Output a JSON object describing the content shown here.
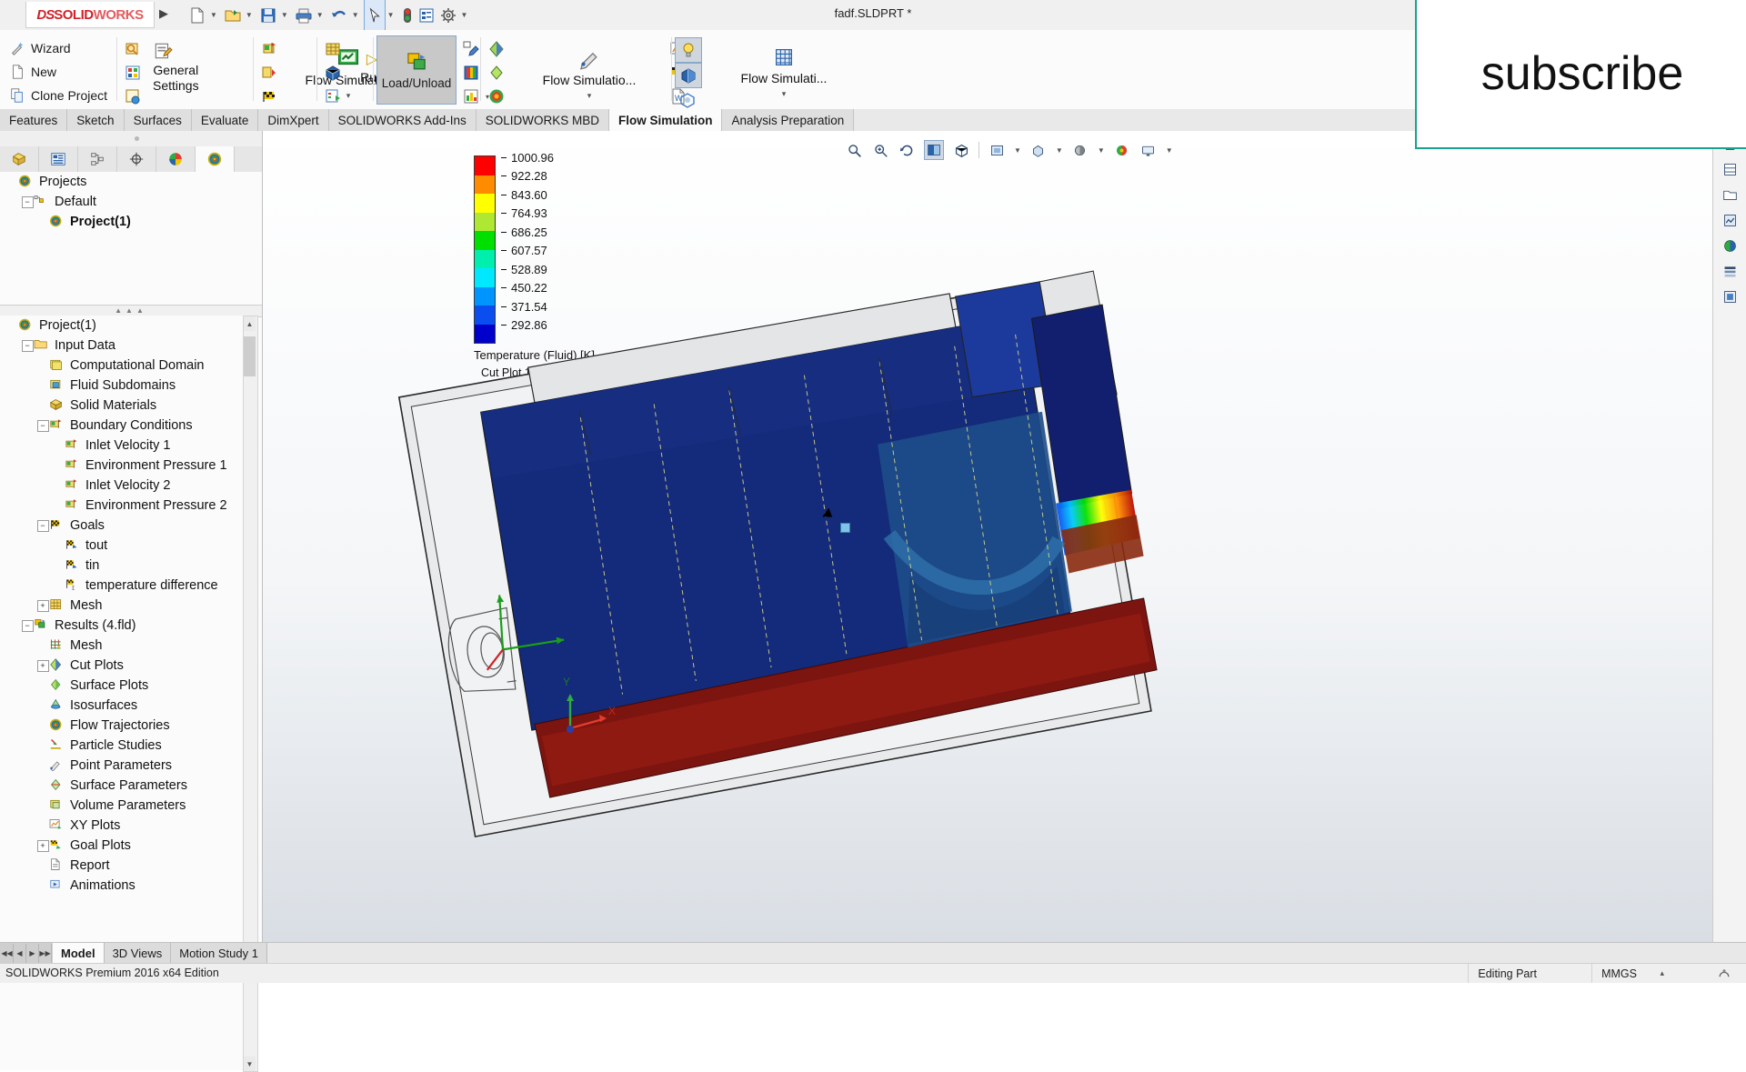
{
  "titlebar": {
    "logo_mark": "DS",
    "logo_solid": "SOLID",
    "logo_works": "WORKS",
    "document_title": "fadf.SLDPRT *",
    "expand_arrow": "▶",
    "tools": [
      {
        "name": "new-document",
        "glyph": "🗋",
        "has_caret": true
      },
      {
        "name": "open-document",
        "glyph": "📂",
        "has_caret": true
      },
      {
        "name": "save-document",
        "glyph": "💾",
        "has_caret": true
      },
      {
        "name": "print-document",
        "glyph": "🖨",
        "has_caret": true
      },
      {
        "name": "undo",
        "glyph": "↶",
        "has_caret": true
      },
      {
        "name": "select",
        "glyph": "➤",
        "has_caret": true,
        "selected": true
      },
      {
        "name": "rebuild",
        "glyph": "🚦",
        "has_caret": false
      },
      {
        "name": "options-list",
        "glyph": "☰",
        "has_caret": false
      },
      {
        "name": "settings-gear",
        "glyph": "⚙",
        "has_caret": true
      }
    ]
  },
  "ribbon": {
    "group_project": [
      {
        "label": "Wizard",
        "icon": "wand-icon"
      },
      {
        "label": "New",
        "icon": "new-file-icon"
      },
      {
        "label": "Clone Project",
        "icon": "clone-icon"
      }
    ],
    "group_settings": {
      "label": "General Settings",
      "icons": [
        "zoom-domain-icon",
        "materials-icon",
        "boundary-icon",
        "checklist-icon"
      ]
    },
    "group_flow": {
      "label": "Flow Simulati...",
      "caret": "▾",
      "icons": [
        "goal-flag-icon",
        "insert-goal-icon",
        "checkered-flag-icon",
        "ribbon-icon"
      ]
    },
    "group_run": {
      "label": "Run",
      "play": "▷",
      "icons": [
        "mesh-icon",
        "solid-mesh-icon",
        "solver-list-icon"
      ]
    },
    "group_load": {
      "label": "Load/Unload",
      "icon": "load-unload-icon",
      "selected": true,
      "side_icons": [
        "picker-icon",
        "save-results-icon",
        "bar-chart-icon"
      ],
      "caret": "▾"
    },
    "group_plots": {
      "label": "Flow Simulatio...",
      "caret": "▾",
      "icons": [
        "cut-plot-icon",
        "surface-plot-icon",
        "isosurface-icon",
        "flow-trajectory-icon",
        "pen-icon"
      ]
    },
    "group_reports": {
      "icons": [
        "xy-plot-icon",
        "goal-plot-icon",
        "word-report-icon"
      ],
      "caret": "▾"
    },
    "group_display": {
      "label": "Flow Simulati...",
      "caret": "▾",
      "icons": [
        "lightbulb-icon",
        "section-view-icon",
        "transparency-icon",
        "grid-icon"
      ],
      "selected_icons": [
        "lightbulb-icon",
        "section-view-icon"
      ]
    }
  },
  "command_tabs": [
    {
      "label": "Features",
      "active": false
    },
    {
      "label": "Sketch",
      "active": false
    },
    {
      "label": "Surfaces",
      "active": false
    },
    {
      "label": "Evaluate",
      "active": false
    },
    {
      "label": "DimXpert",
      "active": false
    },
    {
      "label": "SOLIDWORKS Add-Ins",
      "active": false
    },
    {
      "label": "SOLIDWORKS MBD",
      "active": false
    },
    {
      "label": "Flow Simulation",
      "active": true
    },
    {
      "label": "Analysis Preparation",
      "active": false
    }
  ],
  "panel": {
    "tabs": [
      {
        "name": "feature-manager-tab",
        "icon": "feature-tree-icon",
        "active": false
      },
      {
        "name": "property-manager-tab",
        "icon": "property-list-icon",
        "active": false
      },
      {
        "name": "configuration-manager-tab",
        "icon": "configuration-icon",
        "active": false
      },
      {
        "name": "dimxpert-manager-tab",
        "icon": "target-icon",
        "active": false
      },
      {
        "name": "display-manager-tab",
        "icon": "appearance-sphere-icon",
        "active": false
      },
      {
        "name": "flow-simulation-tab",
        "icon": "flow-rings-icon",
        "active": true
      }
    ],
    "tree_top": [
      {
        "label": "Projects",
        "depth": 0,
        "icon": "flow-rings-icon",
        "toggle": "",
        "bold": false
      },
      {
        "label": "Default",
        "depth": 1,
        "icon": "configuration-icon",
        "toggle": "-",
        "bold": false
      },
      {
        "label": "Project(1)",
        "depth": 2,
        "icon": "flow-rings-icon",
        "toggle": "",
        "bold": true
      }
    ],
    "tree_bottom": [
      {
        "label": "Project(1)",
        "depth": 0,
        "icon": "flow-rings-icon",
        "toggle": "",
        "bold": false
      },
      {
        "label": "Input Data",
        "depth": 1,
        "icon": "folder-icon",
        "toggle": "-",
        "bold": false
      },
      {
        "label": "Computational Domain",
        "depth": 2,
        "icon": "domain-box-icon",
        "toggle": "",
        "bold": false
      },
      {
        "label": "Fluid Subdomains",
        "depth": 2,
        "icon": "fluid-subdomain-icon",
        "toggle": "",
        "bold": false
      },
      {
        "label": "Solid Materials",
        "depth": 2,
        "icon": "solid-material-icon",
        "toggle": "",
        "bold": false
      },
      {
        "label": "Boundary Conditions",
        "depth": 2,
        "icon": "boundary-flag-icon",
        "toggle": "-",
        "bold": false
      },
      {
        "label": "Inlet Velocity 1",
        "depth": 3,
        "icon": "boundary-flag-icon",
        "toggle": "",
        "bold": false
      },
      {
        "label": "Environment Pressure 1",
        "depth": 3,
        "icon": "boundary-flag-icon",
        "toggle": "",
        "bold": false
      },
      {
        "label": "Inlet Velocity 2",
        "depth": 3,
        "icon": "boundary-flag-icon",
        "toggle": "",
        "bold": false
      },
      {
        "label": "Environment Pressure 2",
        "depth": 3,
        "icon": "boundary-flag-icon",
        "toggle": "",
        "bold": false
      },
      {
        "label": "Goals",
        "depth": 2,
        "icon": "checkered-flag-icon",
        "toggle": "-",
        "bold": false
      },
      {
        "label": "tout",
        "depth": 3,
        "icon": "goal-flag-icon",
        "toggle": "",
        "bold": false
      },
      {
        "label": "tin",
        "depth": 3,
        "icon": "goal-flag-icon",
        "toggle": "",
        "bold": false
      },
      {
        "label": "temperature difference",
        "depth": 3,
        "icon": "equation-goal-icon",
        "toggle": "",
        "bold": false
      },
      {
        "label": "Mesh",
        "depth": 2,
        "icon": "mesh-grid-icon",
        "toggle": "+",
        "bold": false
      },
      {
        "label": "Results (4.fld)",
        "depth": 1,
        "icon": "results-icon",
        "toggle": "-",
        "bold": false
      },
      {
        "label": "Mesh",
        "depth": 2,
        "icon": "results-mesh-icon",
        "toggle": "",
        "bold": false
      },
      {
        "label": "Cut Plots",
        "depth": 2,
        "icon": "cut-plot-icon",
        "toggle": "+",
        "bold": false
      },
      {
        "label": "Surface Plots",
        "depth": 2,
        "icon": "surface-plot-icon",
        "toggle": "",
        "bold": false
      },
      {
        "label": "Isosurfaces",
        "depth": 2,
        "icon": "isosurface-icon",
        "toggle": "",
        "bold": false
      },
      {
        "label": "Flow Trajectories",
        "depth": 2,
        "icon": "flow-rings-icon",
        "toggle": "",
        "bold": false
      },
      {
        "label": "Particle Studies",
        "depth": 2,
        "icon": "particle-study-icon",
        "toggle": "",
        "bold": false
      },
      {
        "label": "Point Parameters",
        "depth": 2,
        "icon": "point-parameter-icon",
        "toggle": "",
        "bold": false
      },
      {
        "label": "Surface Parameters",
        "depth": 2,
        "icon": "surface-parameter-icon",
        "toggle": "",
        "bold": false
      },
      {
        "label": "Volume Parameters",
        "depth": 2,
        "icon": "volume-parameter-icon",
        "toggle": "",
        "bold": false
      },
      {
        "label": "XY Plots",
        "depth": 2,
        "icon": "xy-plot-icon",
        "toggle": "",
        "bold": false
      },
      {
        "label": "Goal Plots",
        "depth": 2,
        "icon": "goal-plot-icon",
        "toggle": "+",
        "bold": false
      },
      {
        "label": "Report",
        "depth": 2,
        "icon": "report-icon",
        "toggle": "",
        "bold": false
      },
      {
        "label": "Animations",
        "depth": 2,
        "icon": "animation-icon",
        "toggle": "",
        "bold": false
      }
    ]
  },
  "view_toolbar": [
    {
      "name": "zoom-to-fit-icon",
      "glyph": "⌕",
      "caret": false
    },
    {
      "name": "zoom-area-icon",
      "glyph": "⌕",
      "caret": false
    },
    {
      "name": "rotate-view-icon",
      "glyph": "⟳",
      "caret": false
    },
    {
      "name": "section-view-icon",
      "glyph": "◧",
      "caret": false,
      "selected": true
    },
    {
      "name": "view-orientation-icon",
      "glyph": "⧉",
      "caret": false
    },
    {
      "name": "display-style-icon",
      "glyph": "▣",
      "caret": true
    },
    {
      "name": "hide-show-items-icon",
      "glyph": "▦",
      "caret": true
    },
    {
      "name": "edit-appearance-icon",
      "glyph": "◉",
      "caret": true
    },
    {
      "name": "apply-scene-icon",
      "glyph": "◑",
      "caret": true
    },
    {
      "name": "view-settings-icon",
      "glyph": "▭",
      "caret": true
    }
  ],
  "legend": {
    "title": "Temperature (Fluid) [K]",
    "plot_label": "Cut Plot 1: contours",
    "values": [
      "1000.96",
      "922.28",
      "843.60",
      "764.93",
      "686.25",
      "607.57",
      "528.89",
      "450.22",
      "371.54",
      "292.86"
    ],
    "colors": [
      "#ff0000",
      "#ff8c00",
      "#ffff00",
      "#aee832",
      "#00e000",
      "#00efad",
      "#00e8ff",
      "#0094ff",
      "#0b4ef0",
      "#0000cc"
    ]
  },
  "triad": {
    "x": "X",
    "y": "Y"
  },
  "rail": [
    {
      "name": "home-icon",
      "glyph": "⌂"
    },
    {
      "name": "tree-display-icon",
      "glyph": "▤"
    },
    {
      "name": "open-folder-icon",
      "glyph": "□"
    },
    {
      "name": "appearances-icon",
      "glyph": "▥"
    },
    {
      "name": "scenes-icon",
      "glyph": "◐"
    },
    {
      "name": "decals-icon",
      "glyph": "≣"
    },
    {
      "name": "custom-icon",
      "glyph": "▨"
    }
  ],
  "bottom_tabs": [
    {
      "label": "Model",
      "active": true
    },
    {
      "label": "3D Views",
      "active": false
    },
    {
      "label": "Motion Study 1",
      "active": false
    }
  ],
  "nav_buttons": [
    "⏮",
    "◀",
    "▶",
    "⏭"
  ],
  "status": {
    "edition": "SOLIDWORKS Premium 2016 x64 Edition",
    "editing": "Editing Part",
    "units": "MMGS",
    "units_caret": "▴",
    "rebuild_icon": "rebuild-status-icon"
  },
  "overlay": {
    "subscribe": "subscribe",
    "border_color": "#17a38b"
  }
}
